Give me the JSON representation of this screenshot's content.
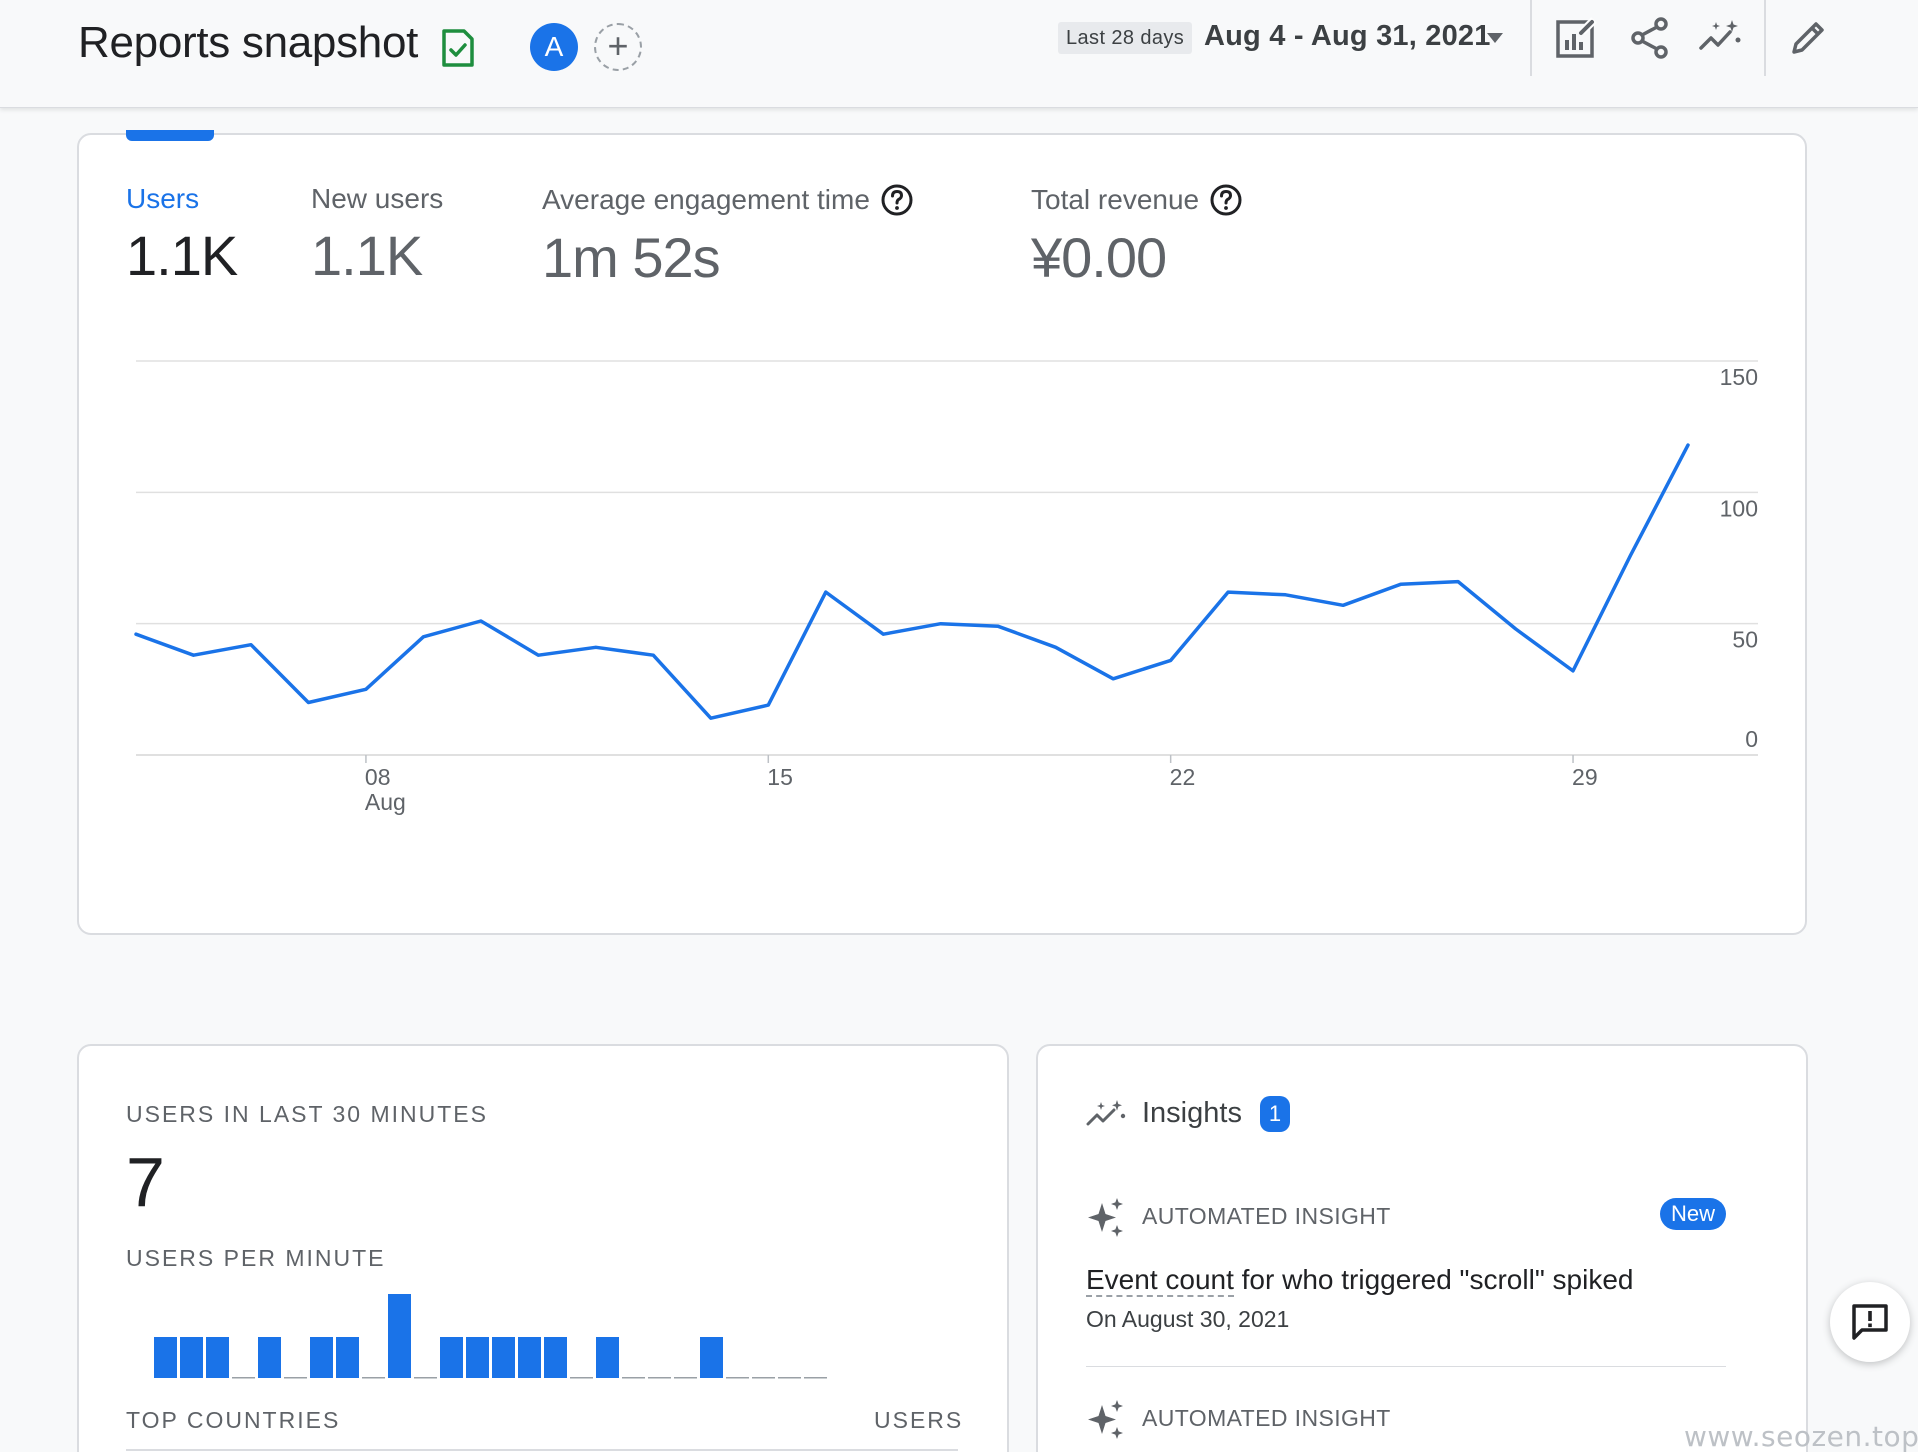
{
  "header": {
    "title": "Reports snapshot",
    "avatar_letter": "A",
    "add_label": "+",
    "date_chip": "Last 28 days",
    "date_range": "Aug 4 - Aug 31, 2021"
  },
  "metrics": [
    {
      "label": "Users",
      "value": "1.1K"
    },
    {
      "label": "New users",
      "value": "1.1K"
    },
    {
      "label": "Average engagement time",
      "value": "1m 52s"
    },
    {
      "label": "Total revenue",
      "value": "¥0.00"
    }
  ],
  "chart_data": {
    "type": "line",
    "x": [
      "Aug 4",
      "Aug 5",
      "Aug 6",
      "Aug 7",
      "Aug 8",
      "Aug 9",
      "Aug 10",
      "Aug 11",
      "Aug 12",
      "Aug 13",
      "Aug 14",
      "Aug 15",
      "Aug 16",
      "Aug 17",
      "Aug 18",
      "Aug 19",
      "Aug 20",
      "Aug 21",
      "Aug 22",
      "Aug 23",
      "Aug 24",
      "Aug 25",
      "Aug 26",
      "Aug 27",
      "Aug 28",
      "Aug 29",
      "Aug 30",
      "Aug 31"
    ],
    "series": [
      {
        "values": [
          46,
          38,
          42,
          20,
          25,
          45,
          51,
          38,
          41,
          38,
          14,
          19,
          62,
          46,
          50,
          49,
          41,
          29,
          36,
          62,
          61,
          57,
          65,
          66,
          48,
          32,
          76,
          118
        ]
      }
    ],
    "x_ticks": [
      {
        "label": "08",
        "sub": "Aug",
        "x": "Aug 8"
      },
      {
        "label": "15",
        "sub": "",
        "x": "Aug 15"
      },
      {
        "label": "22",
        "sub": "",
        "x": "Aug 22"
      },
      {
        "label": "29",
        "sub": "",
        "x": "Aug 29"
      }
    ],
    "y_ticks": [
      0,
      50,
      100,
      150
    ],
    "ylim": [
      0,
      150
    ],
    "color": "#1a73e8",
    "grid": true
  },
  "realtime": {
    "caption": "USERS IN LAST 30 MINUTES",
    "count": "7",
    "per_minute_caption": "USERS PER MINUTE",
    "per_minute": [
      1,
      1,
      1,
      0,
      1,
      0,
      1,
      1,
      0,
      2,
      0,
      1,
      1,
      1,
      1,
      1,
      0,
      1,
      0,
      0,
      0,
      1,
      0,
      0,
      0,
      0
    ],
    "countries_caption": "TOP COUNTRIES",
    "users_caption": "USERS"
  },
  "insights": {
    "title": "Insights",
    "badge": "1",
    "items": [
      {
        "type": "AUTOMATED INSIGHT",
        "badge": "New",
        "headline_dotted": "Event count",
        "headline_rest": " for who triggered \"scroll\" spiked",
        "date": "On August 30, 2021"
      },
      {
        "type": "AUTOMATED INSIGHT"
      }
    ]
  },
  "watermark": "www.seozen.top",
  "colors": {
    "accent": "#1a73e8",
    "doc_check": "#1e8e3e"
  }
}
